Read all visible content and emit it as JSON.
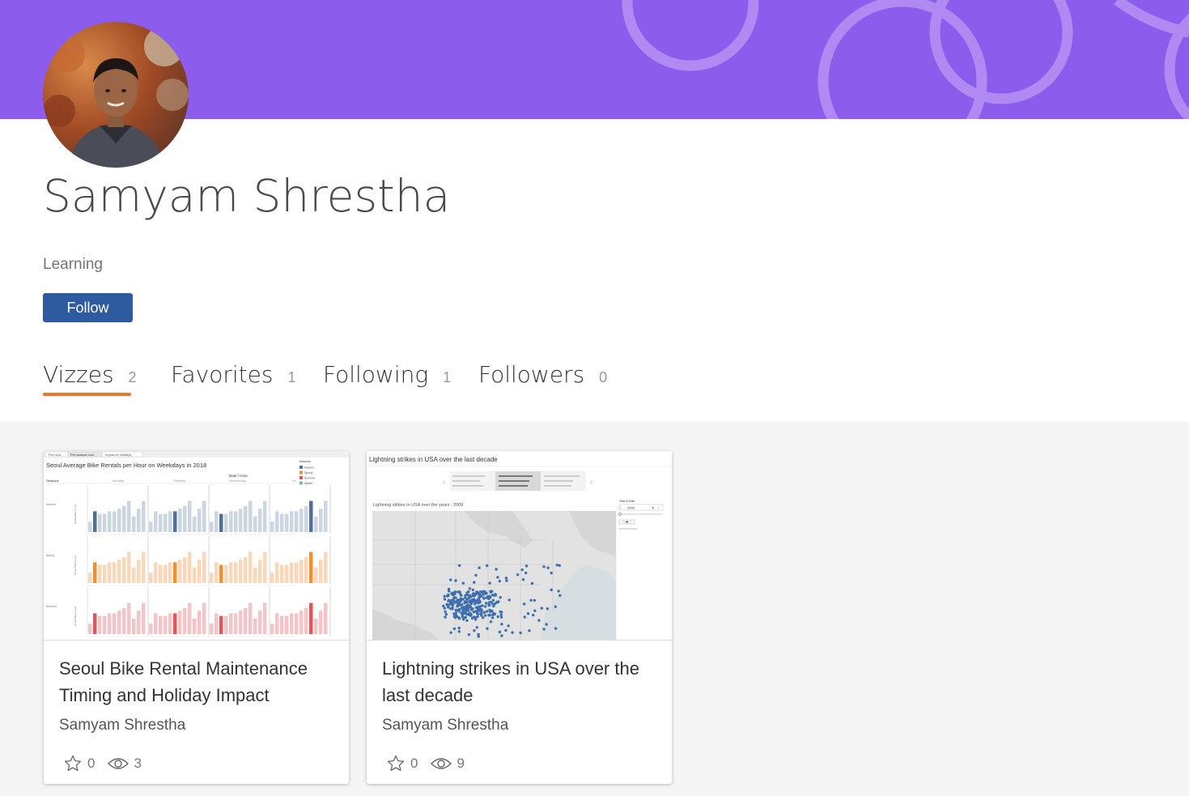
{
  "profile": {
    "name": "Samyam Shrestha",
    "bio": "Learning",
    "follow_label": "Follow",
    "banner_color": "#8c5ced",
    "accent_color": "#e8762c",
    "button_color": "#2e5aa0"
  },
  "tabs": [
    {
      "label": "Vizzes",
      "count": "2",
      "active": true
    },
    {
      "label": "Favorites",
      "count": "1",
      "active": false
    },
    {
      "label": "Following",
      "count": "1",
      "active": false
    },
    {
      "label": "Followers",
      "count": "0",
      "active": false
    }
  ],
  "vizzes": [
    {
      "title": "Seoul Bike Rental Maintenance Timing and Holiday Impact",
      "author": "Samyam Shrestha",
      "favorites": "0",
      "views": "3",
      "thumb": {
        "tabs": [
          "Per hour",
          "Per season hour",
          "Impact of holidays"
        ],
        "heading": "Seoul Average Bike Rentals per Hour on Weekdays in 2018",
        "column_header": "Date / Hour",
        "days": [
          "Monday",
          "Tuesday",
          "Wednesday",
          "Th"
        ],
        "row_header": "Seasons",
        "rows": [
          "Autumn",
          "Spring",
          "Summer"
        ],
        "axis_title": "Rental Bike Count",
        "legend_title": "Seasons",
        "legend": [
          "Autumn",
          "Spring",
          "Summer",
          "Winter"
        ]
      }
    },
    {
      "title": "Lightning strikes in USA over the last decade",
      "author": "Samyam Shrestha",
      "favorites": "0",
      "views": "9",
      "thumb": {
        "heading": "Lightning strikes in USA over the last decade",
        "caption": "Lightning strikes in USA over the years : 2009",
        "filter_label": "Year of Date",
        "filter_value": "2009"
      }
    }
  ],
  "icons": {
    "favorite": "star-outline-icon",
    "views": "eye-icon"
  }
}
